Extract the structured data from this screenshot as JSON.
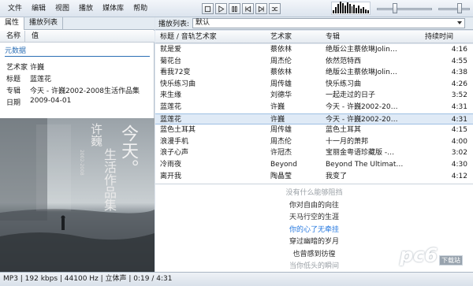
{
  "menu": [
    "文件",
    "编辑",
    "视图",
    "播放",
    "媒体库",
    "帮助"
  ],
  "transport": [
    "stop-icon",
    "play-icon",
    "pause-icon",
    "previous-icon",
    "next-icon",
    "random-icon"
  ],
  "left_tabs": [
    "属性",
    "播放列表"
  ],
  "properties": {
    "col_name": "名称",
    "col_value": "值",
    "group": "元数据",
    "rows": [
      {
        "k": "艺术家",
        "v": "许巍"
      },
      {
        "k": "标题",
        "v": "蓝莲花"
      },
      {
        "k": "专辑",
        "v": "今天 - 许巍2002-2008生活作品集"
      },
      {
        "k": "日期",
        "v": "2009-04-01"
      }
    ]
  },
  "album_art": {
    "big_text": "今天。",
    "name": "许巍",
    "sub": "生活作品集",
    "year": "2002-2008"
  },
  "playlist": {
    "label": "播放列表:",
    "selected": "默认",
    "headers": [
      "标题 / 音轨艺术家",
      "艺术家",
      "专辑",
      "持续时间"
    ],
    "rows": [
      [
        "就是爱",
        "蔡依林",
        "绝版公主蔡依琳Jolin…",
        "4:16"
      ],
      [
        "菊花台",
        "周杰伦",
        "依然范特西",
        "4:55"
      ],
      [
        "看我72变",
        "蔡依林",
        "绝版公主蔡依琳Jolin…",
        "4:38"
      ],
      [
        "快乐练习曲",
        "周传雄",
        "快乐练习曲",
        "4:26"
      ],
      [
        "来生缘",
        "刘德华",
        "一起走过的日子",
        "3:52"
      ],
      [
        "蓝莲花",
        "许巍",
        "今天 - 许巍2002-20…",
        "4:31"
      ],
      [
        "蓝莲花",
        "许巍",
        "今天 - 许巍2002-20…",
        "4:31"
      ],
      [
        "蓝色土耳其",
        "周传雄",
        "蓝色土耳其",
        "4:15"
      ],
      [
        "浪漫手机",
        "周杰伦",
        "十一月的萧邦",
        "4:00"
      ],
      [
        "浪子心声",
        "许冠杰",
        "宝丽金粤语珍藏版 -…",
        "3:02"
      ],
      [
        "冷雨夜",
        "Beyond",
        "Beyond The Ultimat…",
        "4:30"
      ],
      [
        "离开我",
        "陶晶莹",
        "我变了",
        "4:12"
      ]
    ],
    "selected_index": 6
  },
  "lyrics": {
    "lines": [
      "没有什么能够阻挡",
      "你对自由的向往",
      "天马行空的生涯",
      "你的心了无牵挂",
      "穿过幽暗的岁月",
      "也曾感到彷徨",
      "当你低头的瞬间"
    ],
    "current_index": 3
  },
  "status": "MP3 | 192 kbps | 44100 Hz | 立体声 | 0:19 / 4:31",
  "watermark": "pc6",
  "watermark_sub": "下载站",
  "colors": {
    "accent": "#2a7be0",
    "selection": "#dfeaf6"
  }
}
